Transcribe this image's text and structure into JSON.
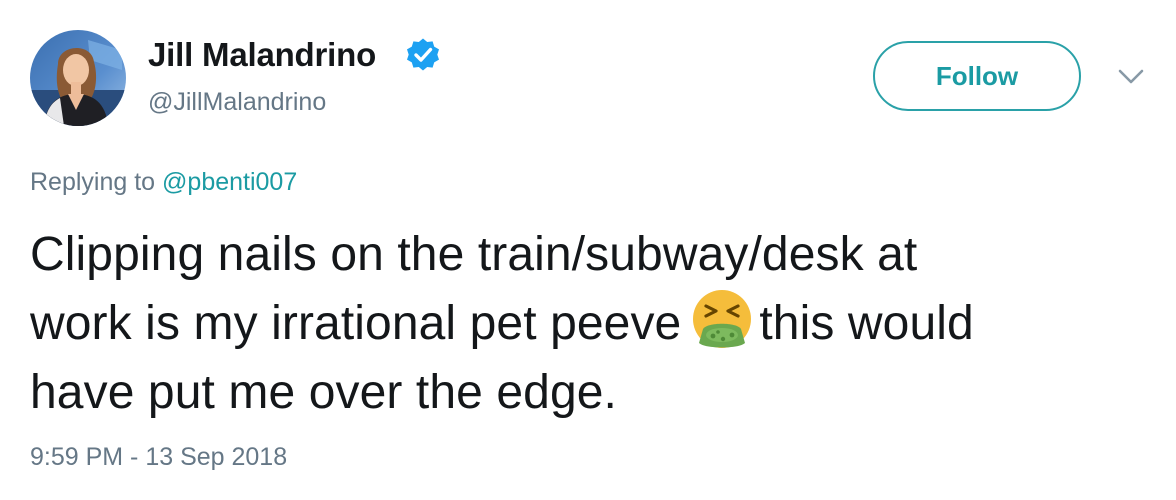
{
  "author": {
    "display_name": "Jill Malandrino",
    "handle": "@JillMalandrino",
    "verified_icon": "verified-badge-icon"
  },
  "actions": {
    "follow_label": "Follow",
    "menu_icon": "chevron-down-icon"
  },
  "reply": {
    "prefix": "Replying to",
    "mention": "@pbenti007"
  },
  "tweet": {
    "line1": "Clipping nails on the train/subway/desk at",
    "line2_before": "work is my irrational pet peeve",
    "emoji": "face-vomiting-emoji",
    "line2_after": "this would",
    "line3": "have put me over the edge."
  },
  "timestamp": "9:59 PM - 13 Sep 2018",
  "colors": {
    "accent": "#1b9ba3",
    "verified": "#1da1f2",
    "secondary_text": "#657786",
    "primary_text": "#14171a"
  }
}
